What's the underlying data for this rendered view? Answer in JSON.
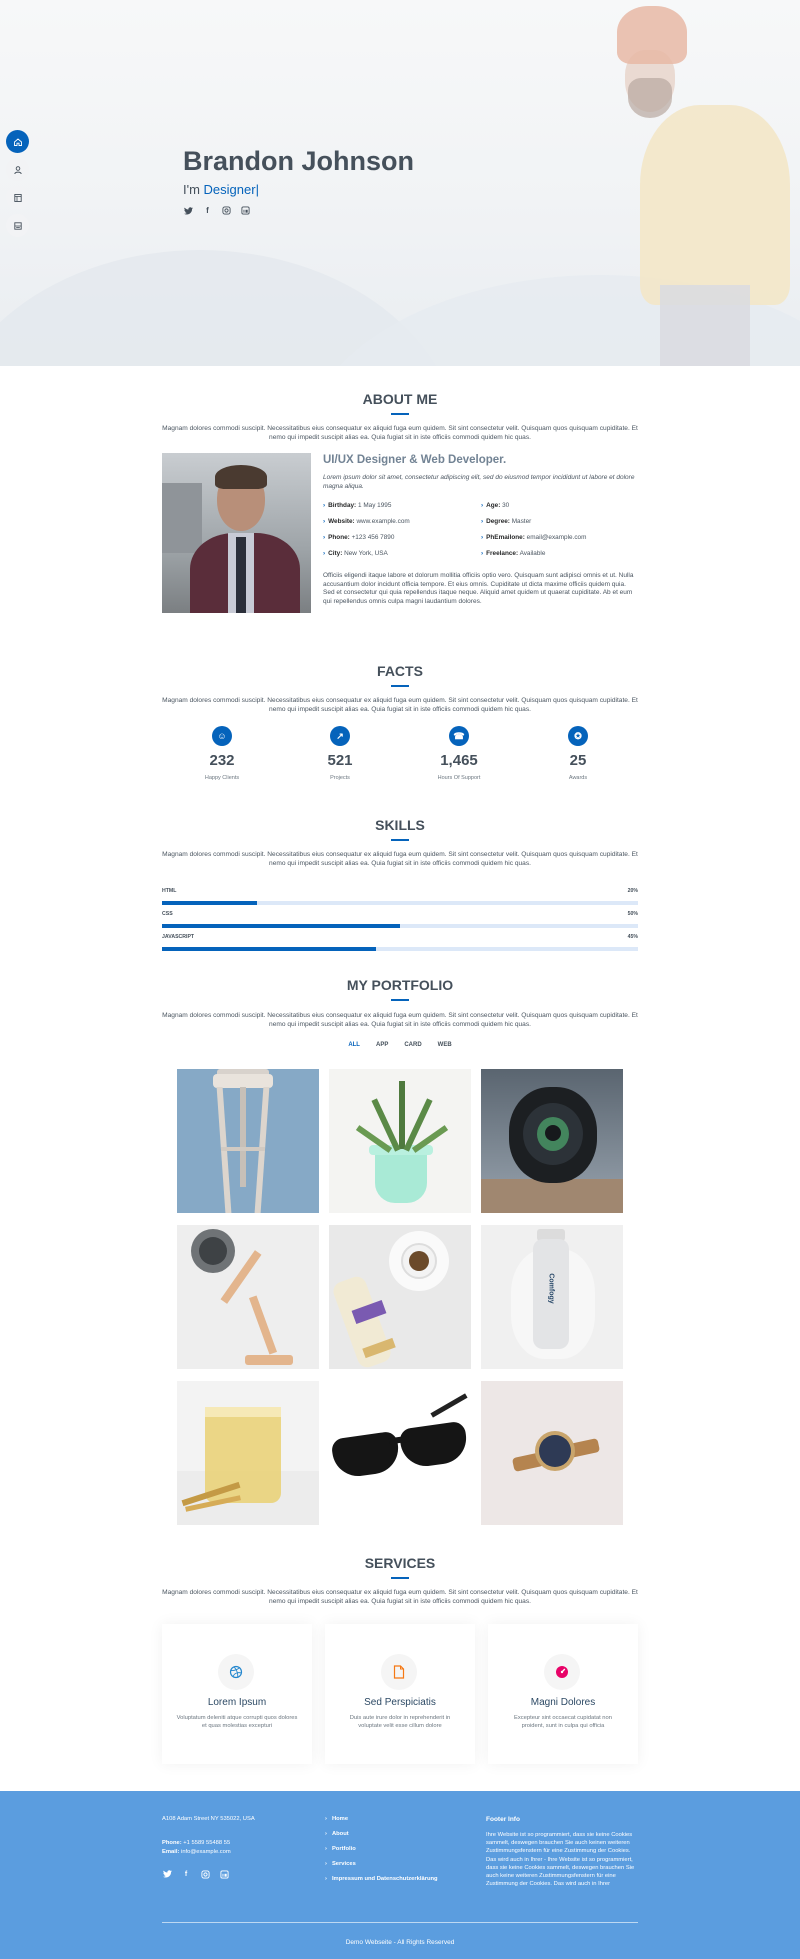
{
  "hero": {
    "name": "Brandon Johnson",
    "prefix": "I'm ",
    "typed": "Designer|",
    "social_icons": [
      "twitter-icon",
      "facebook-icon",
      "instagram-icon",
      "linkedin-icon"
    ]
  },
  "sidenav": {
    "items": [
      {
        "name": "home",
        "icon": "home-icon",
        "active": true
      },
      {
        "name": "about",
        "icon": "user-icon",
        "active": false
      },
      {
        "name": "resume",
        "icon": "file-icon",
        "active": false
      },
      {
        "name": "portfolio",
        "icon": "book-icon",
        "active": false
      }
    ]
  },
  "desc": "Magnam dolores commodi suscipit. Necessitatibus eius consequatur ex aliquid fuga eum quidem. Sit sint consectetur velit. Quisquam quos quisquam cupiditate. Et nemo qui impedit suscipit alias ea. Quia fugiat sit in iste officiis commodi quidem hic quas.",
  "about": {
    "title": "ABOUT ME",
    "heading": "UI/UX Designer & Web Developer.",
    "lead": "Lorem ipsum dolor sit amet, consectetur adipiscing elit, sed do eiusmod tempor incididunt ut labore et dolore magna aliqua.",
    "left": [
      {
        "label": "Birthday:",
        "value": "1 May 1995"
      },
      {
        "label": "Website:",
        "value": "www.example.com"
      },
      {
        "label": "Phone:",
        "value": "+123 456 7890"
      },
      {
        "label": "City:",
        "value": "New York, USA"
      }
    ],
    "right": [
      {
        "label": "Age:",
        "value": "30"
      },
      {
        "label": "Degree:",
        "value": "Master"
      },
      {
        "label": "PhEmailone:",
        "value": "email@example.com"
      },
      {
        "label": "Freelance:",
        "value": "Available"
      }
    ],
    "paragraph": "Officiis eligendi itaque labore et dolorum mollitia officiis optio vero. Quisquam sunt adipisci omnis et ut. Nulla accusantium dolor incidunt officia tempore. Et eius omnis. Cupiditate ut dicta maxime officiis quidem quia. Sed et consectetur qui quia repellendus itaque neque. Aliquid amet quidem ut quaerat cupiditate. Ab et eum qui repellendus omnis culpa magni laudantium dolores."
  },
  "facts": {
    "title": "FACTS",
    "items": [
      {
        "num": "232",
        "label": "Happy Clients",
        "icon": "smile-icon"
      },
      {
        "num": "521",
        "label": "Projects",
        "icon": "journal-icon"
      },
      {
        "num": "1,465",
        "label": "Hours Of Support",
        "icon": "headset-icon"
      },
      {
        "num": "25",
        "label": "Awards",
        "icon": "award-icon"
      }
    ]
  },
  "skills": {
    "title": "SKILLS",
    "items": [
      {
        "name": "HTML",
        "pct_label": "20%",
        "value": 20
      },
      {
        "name": "CSS",
        "pct_label": "50%",
        "value": 50
      },
      {
        "name": "JAVASCRIPT",
        "pct_label": "45%",
        "value": 45
      }
    ]
  },
  "portfolio": {
    "title": "MY PORTFOLIO",
    "filters": [
      "ALL",
      "APP",
      "CARD",
      "WEB"
    ],
    "items": [
      "stool",
      "succulent-plant",
      "camera-lens",
      "desk-lamp",
      "coffee-and-box",
      "cosmetic-bottle",
      "whisky-glass",
      "sunglasses",
      "wrist-watch"
    ],
    "bottle_text": "Comfogy"
  },
  "services": {
    "title": "SERVICES",
    "items": [
      {
        "title": "Lorem Ipsum",
        "desc": "Voluptatum deleniti atque corrupti quos dolores et quas molestias excepturi",
        "icon": "dribbble-icon",
        "color": "#2487ce"
      },
      {
        "title": "Sed Perspiciatis",
        "desc": "Duis aute irure dolor in reprehenderit in voluptate velit esse cillum dolore",
        "icon": "file-icon",
        "color": "#f57813"
      },
      {
        "title": "Magni Dolores",
        "desc": "Excepteur sint occaecat cupidatat non proident, sunt in culpa qui officia",
        "icon": "tachometer-icon",
        "color": "#e80368"
      }
    ]
  },
  "footer": {
    "address": "A108 Adam Street NY 535022, USA",
    "phone_label": "Phone:",
    "phone": "+1 5589 55488 55",
    "email_label": "Email:",
    "email": "info@example.com",
    "links": [
      "Home",
      "About",
      "Portfolio",
      "Services",
      "Impressum und Datenschutzerklärung"
    ],
    "info_title": "Footer Info",
    "info_text": "Ihre Website ist so programmiert, dass sie keine Cookies sammelt, deswegen brauchen Sie auch keinen weiteren Zustimmungsfenstern für eine Zustimmung der Cookies. Das wird auch in Ihrer - Ihre Website ist so programmiert, dass sie keine Cookies sammelt, deswegen brauchen Sie auch keine weiteren Zustimmungsfenstern für eine Zustimmung der Cookies. Das wird auch in Ihrer",
    "copyright": "Demo Webseite - All Rights Reserved"
  },
  "colors": {
    "accent": "#0563bb",
    "footer": "#5b9ddf",
    "heading": "#45505b"
  }
}
